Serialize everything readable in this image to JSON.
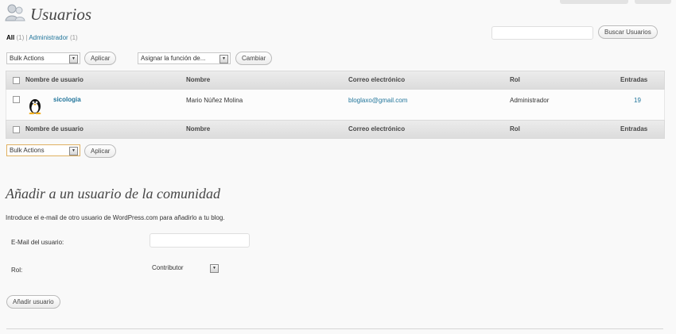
{
  "header": {
    "title": "Usuarios",
    "filter_all": "All",
    "filter_all_count": "(1)",
    "filter_sep": "|",
    "filter_admin": "Administrador",
    "filter_admin_count": "(1)"
  },
  "search": {
    "button_label": "Buscar Usuarios",
    "value": ""
  },
  "top_actions": {
    "bulk_select": "Bulk Actions",
    "apply_label": "Aplicar",
    "role_select": "Asignar la función de...",
    "change_label": "Cambiar"
  },
  "table": {
    "columns": [
      "Nombre de usuario",
      "Nombre",
      "Correo electrónico",
      "Rol",
      "Entradas"
    ],
    "rows": [
      {
        "username": "sicologia",
        "name": "Mario Núñez Molina",
        "email": "bloglaxo@gmail.com",
        "role": "Administrador",
        "posts": "19"
      }
    ]
  },
  "bottom_actions": {
    "bulk_select": "Bulk Actions",
    "apply_label": "Aplicar"
  },
  "add_user": {
    "title": "Añadir a un usuario de la comunidad",
    "description": "Introduce el e-mail de otro usuario de WordPress.com para añadirlo a tu blog.",
    "email_label": "E-Mail del usuario:",
    "email_value": "",
    "role_label": "Rol:",
    "role_value": "Contributor",
    "submit_label": "Añadir usuario"
  },
  "colors": {
    "link": "#21759b",
    "header_bg": "#dcdcdc",
    "page_bg": "#f9f9f9"
  }
}
